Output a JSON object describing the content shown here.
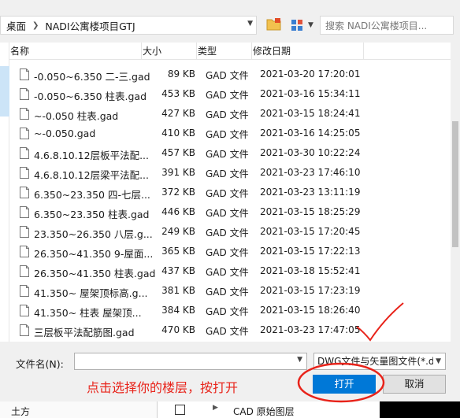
{
  "address": {
    "crumbs": [
      "桌面",
      "NADI公寓楼项目GTJ"
    ]
  },
  "search": {
    "placeholder": "搜索 NADI公寓楼项目..."
  },
  "columns": {
    "name": "名称",
    "size": "大小",
    "type": "类型",
    "modified": "修改日期"
  },
  "files": [
    {
      "name": "-0.050~6.350 二-三.gad",
      "size": "89 KB",
      "type": "GAD 文件",
      "modified": "2021-03-20 17:20:01"
    },
    {
      "name": "-0.050~6.350 柱表.gad",
      "size": "453 KB",
      "type": "GAD 文件",
      "modified": "2021-03-16 15:34:11"
    },
    {
      "name": "~-0.050 柱表.gad",
      "size": "427 KB",
      "type": "GAD 文件",
      "modified": "2021-03-15 18:24:41"
    },
    {
      "name": "~-0.050.gad",
      "size": "410 KB",
      "type": "GAD 文件",
      "modified": "2021-03-16 14:25:05"
    },
    {
      "name": "4.6.8.10.12层板平法配...",
      "size": "457 KB",
      "type": "GAD 文件",
      "modified": "2021-03-30 10:22:24"
    },
    {
      "name": "4.6.8.10.12层梁平法配...",
      "size": "391 KB",
      "type": "GAD 文件",
      "modified": "2021-03-23 17:46:10"
    },
    {
      "name": "6.350~23.350 四-七层...",
      "size": "372 KB",
      "type": "GAD 文件",
      "modified": "2021-03-23 13:11:19"
    },
    {
      "name": "6.350~23.350 柱表.gad",
      "size": "446 KB",
      "type": "GAD 文件",
      "modified": "2021-03-15 18:25:29"
    },
    {
      "name": "23.350~26.350 八层.g...",
      "size": "249 KB",
      "type": "GAD 文件",
      "modified": "2021-03-15 17:20:45"
    },
    {
      "name": "26.350~41.350 9-屋面...",
      "size": "365 KB",
      "type": "GAD 文件",
      "modified": "2021-03-15 17:22:13"
    },
    {
      "name": "26.350~41.350 柱表.gad",
      "size": "437 KB",
      "type": "GAD 文件",
      "modified": "2021-03-18 15:52:41"
    },
    {
      "name": "41.350~ 屋架顶标高.g...",
      "size": "381 KB",
      "type": "GAD 文件",
      "modified": "2021-03-15 17:23:19"
    },
    {
      "name": "41.350~ 柱表 屋架顶...",
      "size": "384 KB",
      "type": "GAD 文件",
      "modified": "2021-03-15 18:26:40"
    },
    {
      "name": "三层板平法配筋图.gad",
      "size": "470 KB",
      "type": "GAD 文件",
      "modified": "2021-03-23 17:47:05"
    }
  ],
  "bottom": {
    "filename_label": "文件名(N):",
    "filename_value": "",
    "filter": "DWG文件与矢量图文件(*.dv",
    "open_label": "打开",
    "cancel_label": "取消"
  },
  "annotation": "点击选择你的楼层，按打开",
  "background": {
    "left_text": "土方",
    "right_text": "CAD 原始图层"
  },
  "colors": {
    "accent": "#0078d7",
    "annotation": "#e8231a",
    "selection": "#cce4f7"
  }
}
